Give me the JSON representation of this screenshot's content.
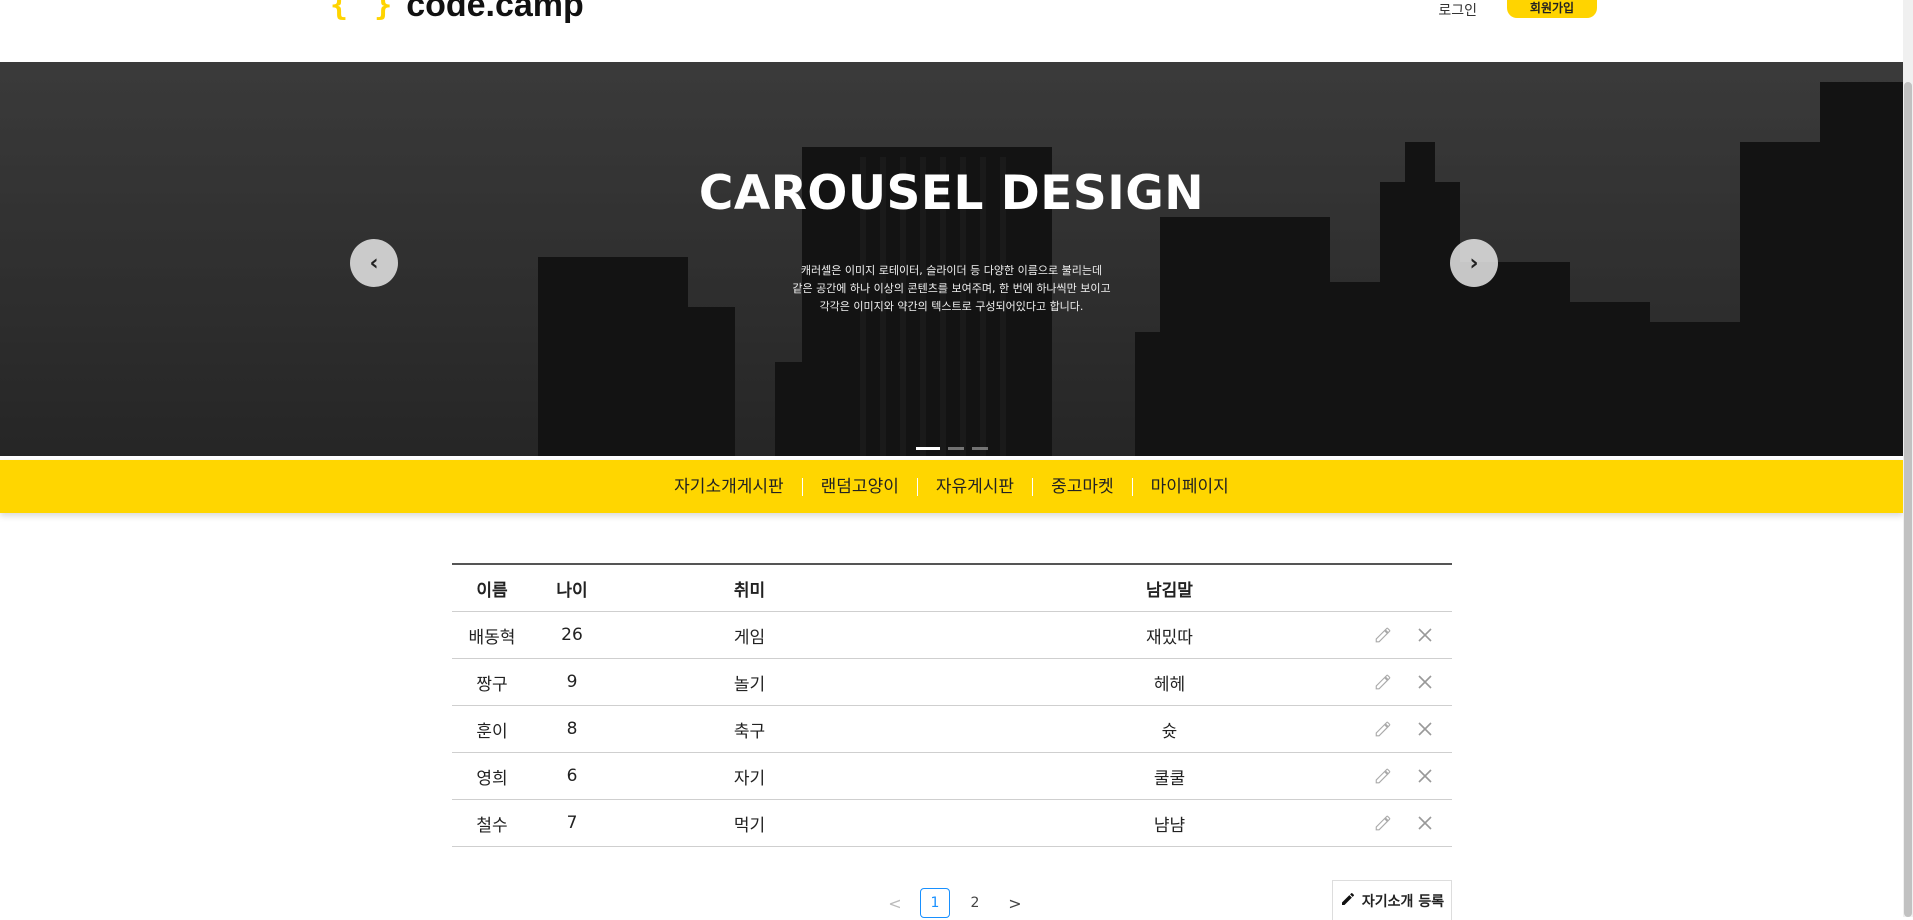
{
  "header": {
    "logo_braces": "{ }",
    "logo_text": "code.camp",
    "login_label": "로그인",
    "signup_label": "회원가입"
  },
  "carousel": {
    "title": "CAROUSEL DESIGN",
    "description": [
      "캐러셀은 이미지 로테이터, 슬라이더 등 다양한 이름으로 불리는데",
      "같은 공간에 하나 이상의 콘텐츠를 보여주며, 한 번에 하나씩만 보이고",
      "각각은 이미지와 약간의 텍스트로 구성되어있다고 합니다."
    ],
    "prev_icon": "‹",
    "next_icon": "›",
    "slide_count": 3,
    "active_slide": 1
  },
  "nav": {
    "items": [
      "자기소개게시판",
      "랜덤고양이",
      "자유게시판",
      "중고마켓",
      "마이페이지"
    ]
  },
  "table": {
    "headers": {
      "name": "이름",
      "age": "나이",
      "hobby": "취미",
      "message": "남김말"
    },
    "rows": [
      {
        "name": "배동혁",
        "age": "26",
        "hobby": "게임",
        "message": "재밌따"
      },
      {
        "name": "짱구",
        "age": "9",
        "hobby": "놀기",
        "message": "헤헤"
      },
      {
        "name": "훈이",
        "age": "8",
        "hobby": "축구",
        "message": "슛"
      },
      {
        "name": "영희",
        "age": "6",
        "hobby": "자기",
        "message": "쿨쿨"
      },
      {
        "name": "철수",
        "age": "7",
        "hobby": "먹기",
        "message": "냠냠"
      }
    ]
  },
  "pagination": {
    "pages": [
      "1",
      "2"
    ],
    "current": "1",
    "prev_icon": "<",
    "next_icon": ">"
  },
  "register_button": {
    "label": "자기소개 등록",
    "icon": "pencil-icon"
  },
  "colors": {
    "accent": "#ffd600",
    "page_active": "#1890ff"
  }
}
